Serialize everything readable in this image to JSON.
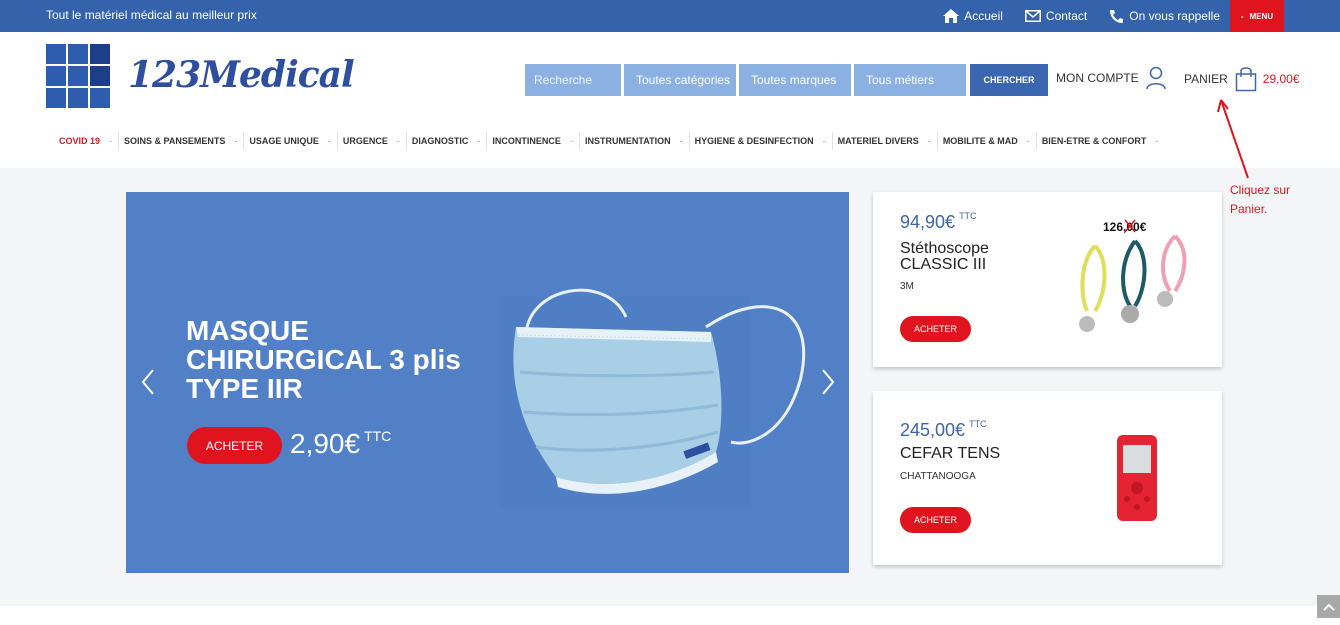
{
  "topbar": {
    "tagline": "Tout le matériel médical au meilleur prix",
    "home_label": "Accueil",
    "contact_label": "Contact",
    "callback_label": "On vous rappelle",
    "menu_dash": "-",
    "menu_label": "MENU"
  },
  "header": {
    "logo_text": "123Medical",
    "search_placeholder": "Recherche",
    "category_select": "Toutes catégories",
    "brand_select": "Toutes marques",
    "trade_select": "Tous métiers",
    "search_button": "CHERCHER",
    "account_label": "MON COMPTE",
    "cart_label": "PANIER",
    "cart_total": "29,00€"
  },
  "nav": {
    "items": [
      {
        "label": "COVID 19"
      },
      {
        "label": "SOINS & PANSEMENTS"
      },
      {
        "label": "USAGE UNIQUE"
      },
      {
        "label": "URGENCE"
      },
      {
        "label": "DIAGNOSTIC"
      },
      {
        "label": "INCONTINENCE"
      },
      {
        "label": "INSTRUMENTATION"
      },
      {
        "label": "HYGIENE & DESINFECTION"
      },
      {
        "label": "MATERIEL DIVERS"
      },
      {
        "label": "MOBILITE & MAD"
      },
      {
        "label": "BIEN-ETRE & CONFORT"
      }
    ],
    "dash": "-"
  },
  "hero": {
    "title_line1": "MASQUE",
    "title_line2": "CHIRURGICAL 3 plis",
    "title_line3": "TYPE IIR",
    "button": "ACHETER",
    "price": "2,90€",
    "price_suffix": "TTC"
  },
  "products": [
    {
      "price": "94,90€",
      "ttc": "TTC",
      "name_line1": "Stéthoscope",
      "name_line2": "CLASSIC III",
      "brand": "3M",
      "button": "ACHETER",
      "old_price": "126,00€"
    },
    {
      "price": "245,00€",
      "ttc": "TTC",
      "name_line1": "CEFAR TENS",
      "name_line2": "",
      "brand": "CHATTANOOGA",
      "button": "ACHETER"
    }
  ],
  "annotation": {
    "line1": "Cliquez sur",
    "line2": "Panier."
  },
  "colors": {
    "topbar": "#3463ac",
    "accent_red": "#e0141e",
    "hero_blue": "#5280c7",
    "select_blue": "#8bb0e2"
  }
}
